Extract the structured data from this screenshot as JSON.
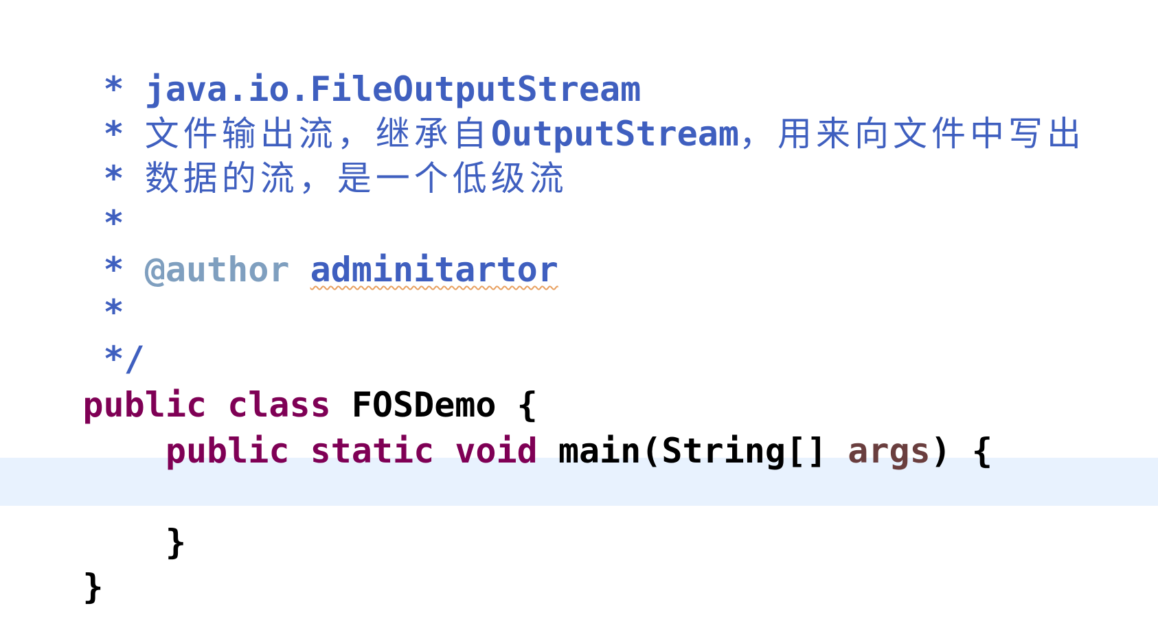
{
  "editor": {
    "comment_lines": [
      {
        "star": " * ",
        "text": "java.io.FileOutputStream"
      },
      {
        "star": " * ",
        "text_a": "文件输出流，继承自",
        "text_b": "OutputStream",
        "text_c": "，用来向文件中写出"
      },
      {
        "star": " * ",
        "text": "数据的流，是一个低级流"
      },
      {
        "star": " *",
        "text": ""
      },
      {
        "star": " * ",
        "tag": "@author",
        "author": "adminitartor"
      },
      {
        "star": " *",
        "text": ""
      },
      {
        "star": " */",
        "text": ""
      }
    ],
    "class_decl": {
      "kw_public": "public",
      "kw_class": "class",
      "name": "FOSDemo",
      "brace_open": "{"
    },
    "method_decl": {
      "kw_public": "public",
      "kw_static": "static",
      "kw_void": "void",
      "name_sig": "main(String[]",
      "param": "args",
      "tail": ") {"
    },
    "method_close": "}",
    "class_close": "}",
    "colors": {
      "javadoc": "#3f5fbf",
      "javadoc_tag": "#7f9fbf",
      "keyword": "#7f0055",
      "parameter": "#6a3e3e",
      "current_line": "#e8f2fe",
      "spell_underline": "#e8a060"
    }
  }
}
